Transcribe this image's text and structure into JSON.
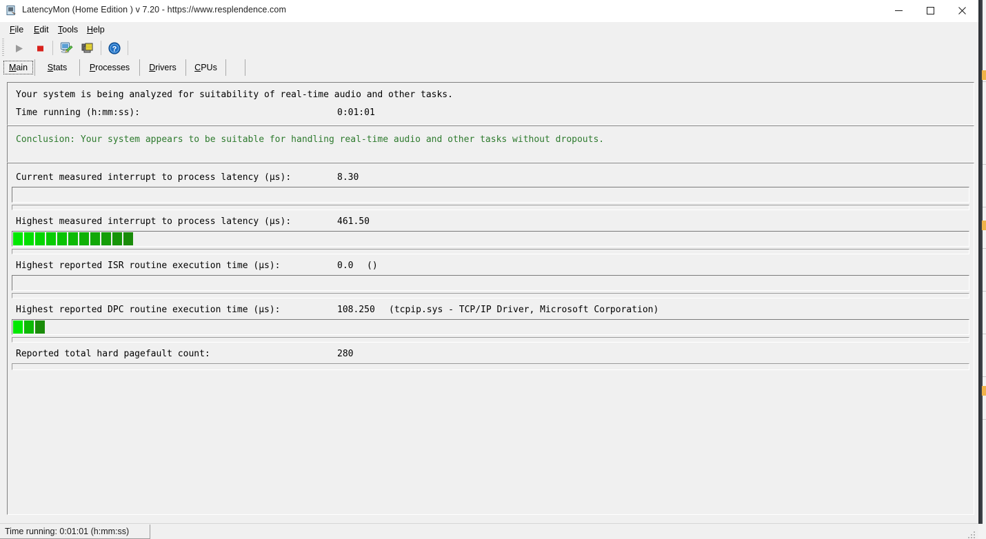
{
  "window": {
    "title": "LatencyMon  (Home Edition )  v 7.20 - https://www.resplendence.com",
    "icon": "app-icon",
    "minimize_label": "—",
    "maximize_label": "□",
    "close_label": "✕"
  },
  "menu": {
    "items": [
      {
        "label": "File",
        "accel": "F"
      },
      {
        "label": "Edit",
        "accel": "E"
      },
      {
        "label": "Tools",
        "accel": "T"
      },
      {
        "label": "Help",
        "accel": "H"
      }
    ]
  },
  "toolbar": {
    "buttons": [
      {
        "name": "start-monitoring-button",
        "icon": "play-icon",
        "enabled": false
      },
      {
        "name": "stop-monitoring-button",
        "icon": "stop-icon",
        "enabled": true
      },
      {
        "name": "system-info-button",
        "icon": "monitor-pen-icon",
        "enabled": true
      },
      {
        "name": "copy-report-button",
        "icon": "layered-squares-icon",
        "enabled": true
      },
      {
        "name": "help-button",
        "icon": "help-circle-icon",
        "enabled": true
      }
    ]
  },
  "tabs": {
    "selected": "Main",
    "items": [
      {
        "label": "Main",
        "accel": "M"
      },
      {
        "label": "Stats",
        "accel": "S"
      },
      {
        "label": "Processes",
        "accel": "P"
      },
      {
        "label": "Drivers",
        "accel": "D"
      },
      {
        "label": "CPUs",
        "accel": "C"
      }
    ]
  },
  "status_panel": {
    "analysis_line": "Your system is being analyzed for suitability of real-time audio and other tasks.",
    "time_label": "Time running (h:mm:ss):",
    "time_value": "0:01:01"
  },
  "conclusion": {
    "text": "Conclusion: Your system appears to be suitable for handling real-time audio and other tasks without dropouts.",
    "color": "#2d7a2d"
  },
  "measurements": [
    {
      "name": "current-interrupt-to-process-latency",
      "label": "Current measured interrupt to process latency (µs):",
      "value": "8.30",
      "extra": "",
      "bar_segments": 0,
      "has_thin_strip": true
    },
    {
      "name": "highest-interrupt-to-process-latency",
      "label": "Highest measured interrupt to process latency (µs):",
      "value": "461.50",
      "extra": "",
      "bar_segments": 11,
      "has_thin_strip": true
    },
    {
      "name": "highest-isr-routine-execution-time",
      "label": "Highest reported ISR routine execution time (µs):",
      "value": "0.0",
      "extra": "()",
      "bar_segments": 0,
      "has_thin_strip": true
    },
    {
      "name": "highest-dpc-routine-execution-time",
      "label": "Highest reported DPC routine execution time (µs):",
      "value": "108.250",
      "extra": "(tcpip.sys - TCP/IP Driver, Microsoft Corporation)",
      "bar_segments": 3,
      "has_thin_strip": true
    },
    {
      "name": "reported-total-hard-pagefault-count",
      "label": "Reported total hard pagefault count:",
      "value": "280",
      "extra": "",
      "bar_segments": 0,
      "has_thin_strip": true,
      "thin_only": true
    }
  ],
  "statusbar": {
    "text": "Time running: 0:01:01  (h:mm:ss)"
  },
  "colors": {
    "bar_bright": "#00e800",
    "bar_dark": "#1a8c0a",
    "conclusion_green": "#2d7a2d",
    "face": "#f0f0f0",
    "title_text": "#222222"
  }
}
